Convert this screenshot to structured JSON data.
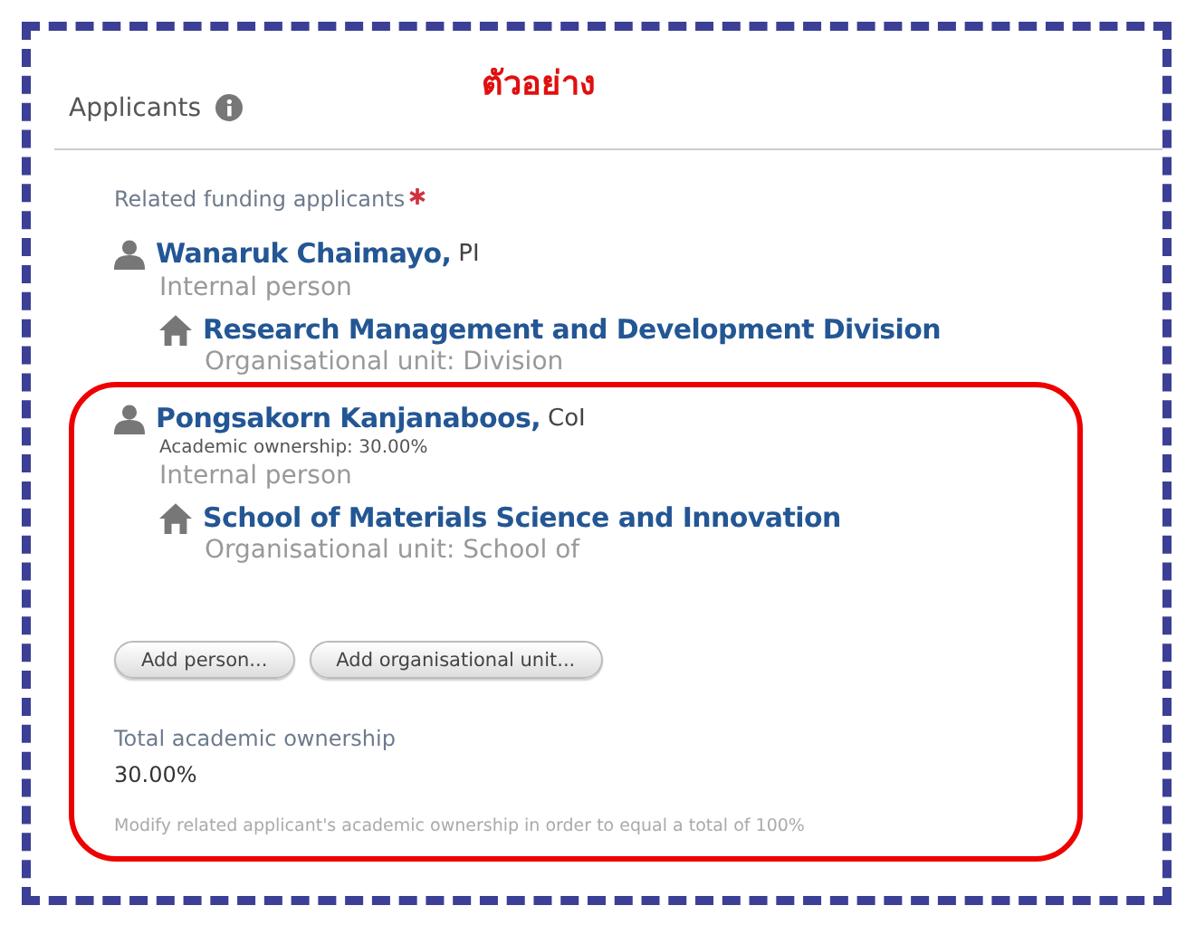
{
  "annotation": {
    "text": "ตัวอย่าง"
  },
  "section": {
    "title": "Applicants"
  },
  "field": {
    "label": "Related funding applicants",
    "required": true
  },
  "applicants": [
    {
      "name": "Wanaruk Chaimayo,",
      "role": "PI",
      "type": "Internal person",
      "unit": {
        "name": "Research Management and Development Division",
        "type": "Organisational unit: Division"
      }
    },
    {
      "name": "Pongsakorn Kanjanaboos,",
      "role": "CoI",
      "ownership": "Academic ownership: 30.00%",
      "type": "Internal person",
      "unit": {
        "name": "School of Materials Science and Innovation",
        "type": "Organisational unit: School of"
      }
    }
  ],
  "buttons": [
    "Add person...",
    "Add organisational unit..."
  ],
  "total": {
    "label": "Total academic ownership",
    "value": "30.00%"
  },
  "hint": "Modify related applicant's academic ownership in order to equal a total of 100%"
}
